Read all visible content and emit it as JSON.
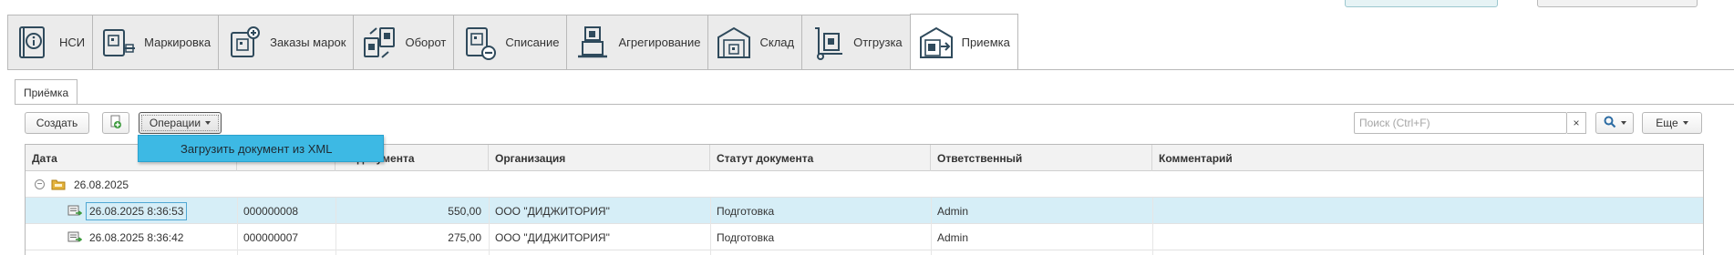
{
  "sections": [
    {
      "label": "НСИ",
      "icon": "info-book-icon"
    },
    {
      "label": "Маркировка",
      "icon": "marking-icon"
    },
    {
      "label": "Заказы марок",
      "icon": "order-marks-icon"
    },
    {
      "label": "Оборот",
      "icon": "turnover-icon"
    },
    {
      "label": "Списание",
      "icon": "write-off-icon"
    },
    {
      "label": "Агрегирование",
      "icon": "aggregation-icon"
    },
    {
      "label": "Склад",
      "icon": "warehouse-icon"
    },
    {
      "label": "Отгрузка",
      "icon": "shipment-icon"
    },
    {
      "label": "Приемка",
      "icon": "acceptance-icon"
    }
  ],
  "active_section": "Приемка",
  "page_tab": "Приёмка",
  "toolbar": {
    "create_label": "Создать",
    "operations_label": "Операции",
    "search_placeholder": "Поиск (Ctrl+F)",
    "clear_label": "×",
    "more_label": "Еще"
  },
  "menu": {
    "items": [
      "Загрузить документ из XML"
    ]
  },
  "table": {
    "columns": [
      "Дата",
      "",
      "№ документа",
      "Организация",
      "Статут документа",
      "Ответственный",
      "Комментарий"
    ],
    "group": "26.08.2025",
    "rows": [
      {
        "date": "26.08.2025 8:36:53",
        "number": "000000008",
        "amount": "550,00",
        "org": "ООО \"ДИДЖИТОРИЯ\"",
        "status": "Подготовка",
        "responsible": "Admin",
        "comment": ""
      },
      {
        "date": "26.08.2025 8:36:42",
        "number": "000000007",
        "amount": "275,00",
        "org": "ООО \"ДИДЖИТОРИЯ\"",
        "status": "Подготовка",
        "responsible": "Admin",
        "comment": ""
      }
    ]
  },
  "colors": {
    "accent": "#3db9e4",
    "selected_row": "#d6eef7",
    "icon_dark": "#2f4a5c",
    "icon_green": "#3c9a3c"
  }
}
